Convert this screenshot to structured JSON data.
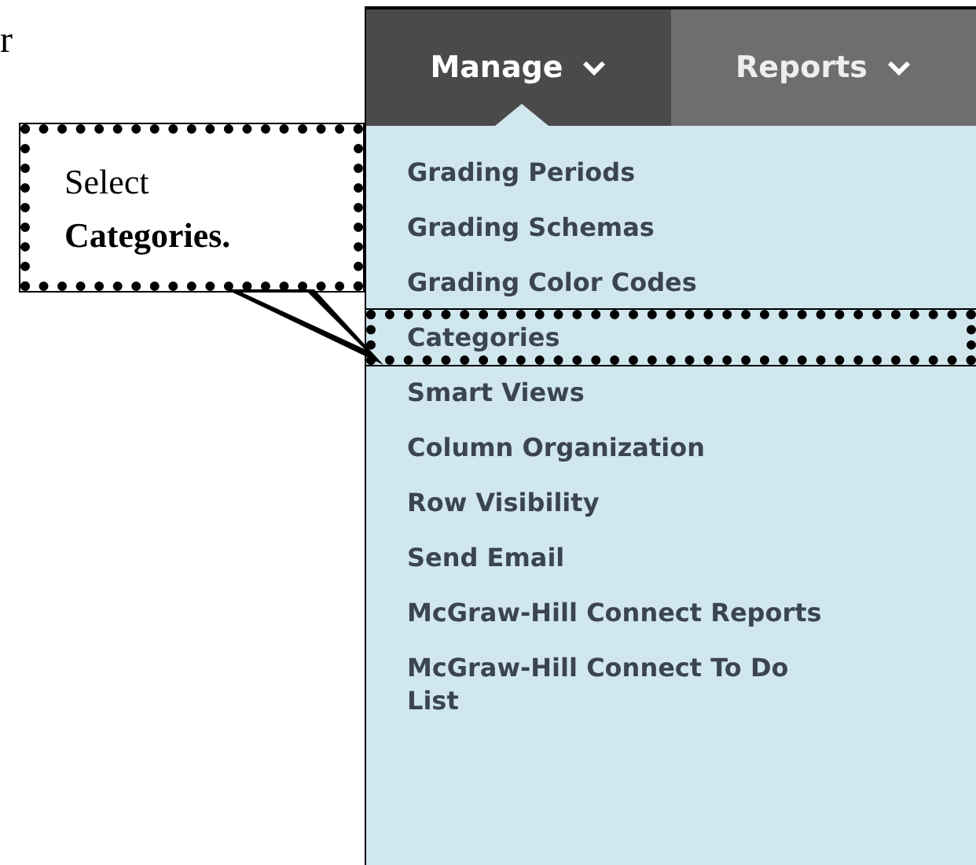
{
  "fragment": "r",
  "nav_tabs": [
    {
      "label": "Manage",
      "selected": true
    },
    {
      "label": "Reports",
      "selected": false
    }
  ],
  "menu_items": [
    {
      "label": "Grading Periods",
      "highlighted": false
    },
    {
      "label": "Grading Schemas",
      "highlighted": false
    },
    {
      "label": "Grading Color Codes",
      "highlighted": false
    },
    {
      "label": "Categories",
      "highlighted": true
    },
    {
      "label": "Smart Views",
      "highlighted": false
    },
    {
      "label": "Column Organization",
      "highlighted": false
    },
    {
      "label": "Row Visibility",
      "highlighted": false
    },
    {
      "label": "Send Email",
      "highlighted": false
    },
    {
      "label": "McGraw-Hill Connect Reports",
      "highlighted": false
    },
    {
      "label": "McGraw-Hill Connect To Do List",
      "highlighted": false
    }
  ],
  "callout": {
    "text": "Select **Categories.**"
  }
}
